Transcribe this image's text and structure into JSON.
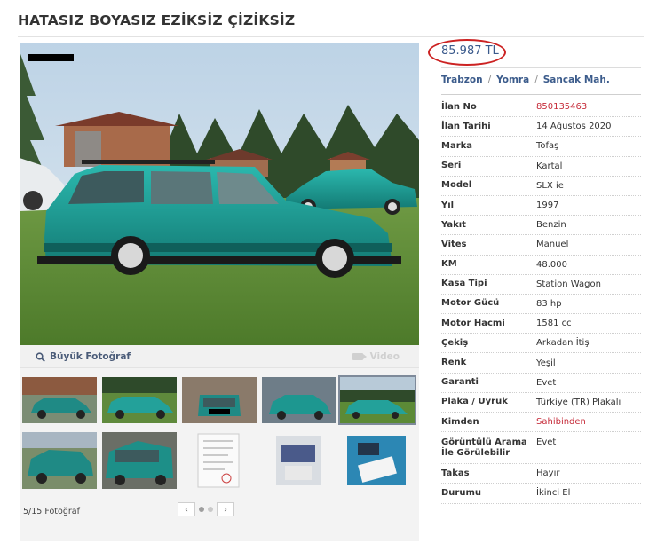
{
  "title": "HATASIZ BOYASIZ EZİKSİZ ÇİZİKSİZ",
  "price": "85.987 TL",
  "location": {
    "city": "Trabzon",
    "district": "Yomra",
    "neighborhood": "Sancak Mah.",
    "separator": "/"
  },
  "specs": [
    {
      "label": "İlan No",
      "value": "850135463",
      "highlight": true
    },
    {
      "label": "İlan Tarihi",
      "value": "14 Ağustos 2020"
    },
    {
      "label": "Marka",
      "value": "Tofaş"
    },
    {
      "label": "Seri",
      "value": "Kartal"
    },
    {
      "label": "Model",
      "value": "SLX ie"
    },
    {
      "label": "Yıl",
      "value": "1997"
    },
    {
      "label": "Yakıt",
      "value": "Benzin"
    },
    {
      "label": "Vites",
      "value": "Manuel"
    },
    {
      "label": "KM",
      "value": "48.000"
    },
    {
      "label": "Kasa Tipi",
      "value": "Station Wagon"
    },
    {
      "label": "Motor Gücü",
      "value": "83 hp"
    },
    {
      "label": "Motor Hacmi",
      "value": "1581 cc"
    },
    {
      "label": "Çekiş",
      "value": "Arkadan İtiş"
    },
    {
      "label": "Renk",
      "value": "Yeşil"
    },
    {
      "label": "Garanti",
      "value": "Evet"
    },
    {
      "label": "Plaka / Uyruk",
      "value": "Türkiye (TR) Plakalı"
    },
    {
      "label": "Kimden",
      "value": "Sahibinden",
      "highlight": true
    },
    {
      "label": "Görüntülü Arama İle Görülebilir",
      "value": "Evet",
      "tall": true
    },
    {
      "label": "Takas",
      "value": "Hayır"
    },
    {
      "label": "Durumu",
      "value": "İkinci El"
    }
  ],
  "gallery": {
    "big_photo_label": "Büyük Fotoğraf",
    "video_label": "Video",
    "photo_count": "5/15 Fotoğraf",
    "prev_label": "‹",
    "next_label": "›",
    "active_thumb": 5,
    "active_page": 0,
    "icons": {
      "big_photo": "magnifier-icon",
      "video": "video-camera-icon"
    }
  },
  "colors": {
    "price_circle": "#cc2222",
    "link_blue": "#3b5b8b",
    "highlight_red": "#c62c3a",
    "car_teal": "#1a9a93"
  }
}
